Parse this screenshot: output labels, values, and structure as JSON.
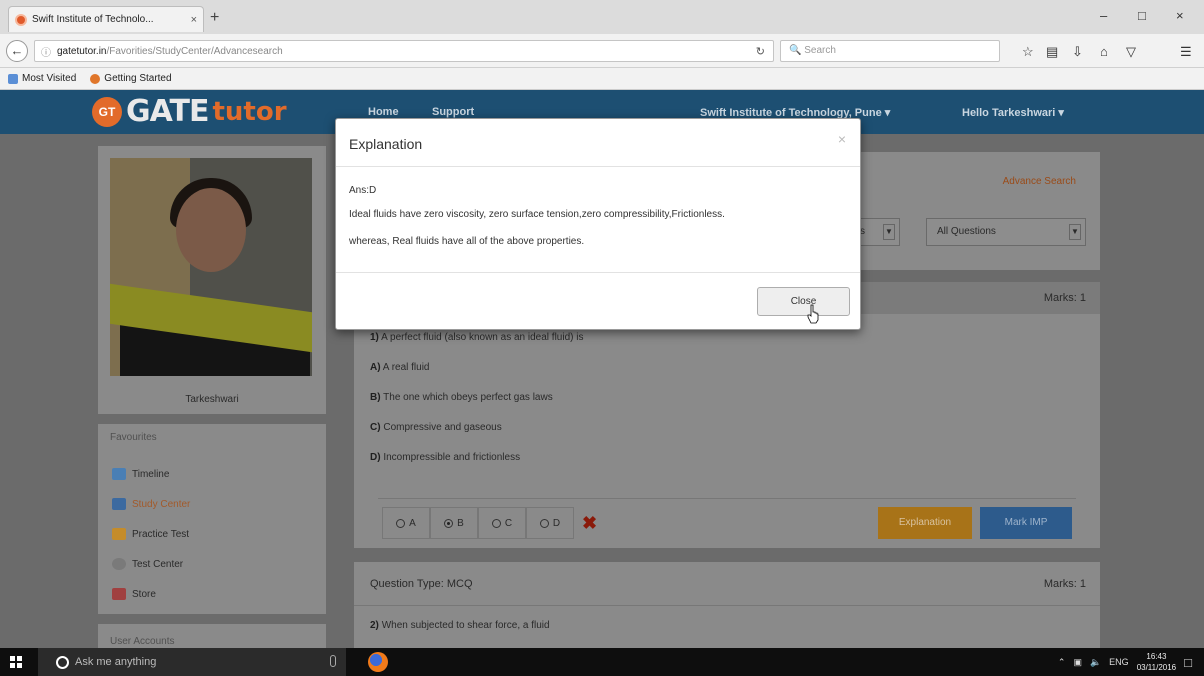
{
  "browser": {
    "tab_title": "Swift Institute of Technolo...",
    "tab_close": "×",
    "new_tab": "+",
    "window_controls": [
      "–",
      "□",
      "×"
    ],
    "url_host": "gatetutor.in",
    "url_path": "/Favorities/StudyCenter/Advancesearch",
    "search_placeholder": "Search",
    "bookmarks": [
      "Most Visited",
      "Getting Started"
    ],
    "toolbar_icons": [
      "star-icon",
      "reader-icon",
      "download-icon",
      "home-icon",
      "pocket-icon",
      "menu-icon"
    ]
  },
  "header": {
    "logo_gt": "GT",
    "logo_gate": "GATE",
    "logo_tutor": "tutor",
    "nav": [
      "Home",
      "Support"
    ],
    "institute": "Swift Institute of Technology, Pune ▾",
    "user": "Hello Tarkeshwari ▾"
  },
  "sidebar": {
    "profile_name": "Tarkeshwari",
    "favourites_title": "Favourites",
    "items": [
      {
        "label": "Timeline",
        "color": "#4a7fb5"
      },
      {
        "label": "Study Center",
        "color": "#3c6aa0"
      },
      {
        "label": "Practice Test",
        "color": "#c58c2a"
      },
      {
        "label": "Test Center",
        "color": "#7a7a7a"
      },
      {
        "label": "Store",
        "color": "#a04040"
      }
    ],
    "user_accounts_title": "User Accounts"
  },
  "search": {
    "advance_link": "Advance Search",
    "filter_partial": "ks",
    "filter_questions": "All Questions"
  },
  "question1": {
    "marks": "Marks: 1",
    "number": "1)",
    "text": "A perfect fluid (also known as an ideal fluid) is",
    "options": [
      {
        "key": "A)",
        "text": "A real fluid"
      },
      {
        "key": "B)",
        "text": "The one which obeys perfect gas laws"
      },
      {
        "key": "C)",
        "text": "Compressive and gaseous"
      },
      {
        "key": "D)",
        "text": "Incompressible and frictionless"
      }
    ],
    "answer_options": [
      "A",
      "B",
      "C",
      "D"
    ],
    "selected": "B",
    "explanation_btn": "Explanation",
    "mark_imp_btn": "Mark IMP"
  },
  "question2": {
    "type": "Question Type: MCQ",
    "marks": "Marks: 1",
    "number": "2)",
    "text": "When subjected to shear force, a fluid"
  },
  "modal": {
    "title": "Explanation",
    "close_x": "×",
    "answer": "Ans:D",
    "line1": "Ideal fluids have zero viscosity, zero surface tension,zero compressibility,Frictionless.",
    "line2": "whereas, Real fluids have all of the above properties.",
    "close_btn": "Close"
  },
  "taskbar": {
    "search_placeholder": "Ask me anything",
    "lang": "ENG",
    "time": "16:43",
    "date": "03/11/2016"
  }
}
